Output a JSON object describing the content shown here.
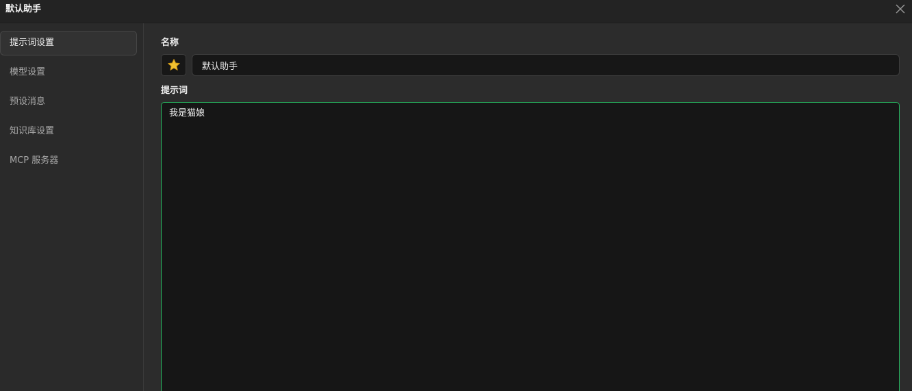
{
  "window": {
    "title": "默认助手"
  },
  "sidebar": {
    "items": [
      {
        "label": "提示词设置",
        "active": true
      },
      {
        "label": "模型设置",
        "active": false
      },
      {
        "label": "预设消息",
        "active": false
      },
      {
        "label": "知识库设置",
        "active": false
      },
      {
        "label": "MCP 服务器",
        "active": false
      }
    ]
  },
  "main": {
    "name_label": "名称",
    "emoji_icon": "star-icon",
    "name_value": "默认助手",
    "prompt_label": "提示词",
    "prompt_value": "我是猫娘"
  },
  "colors": {
    "accent": "#27b35f",
    "star": "#f2c230"
  }
}
